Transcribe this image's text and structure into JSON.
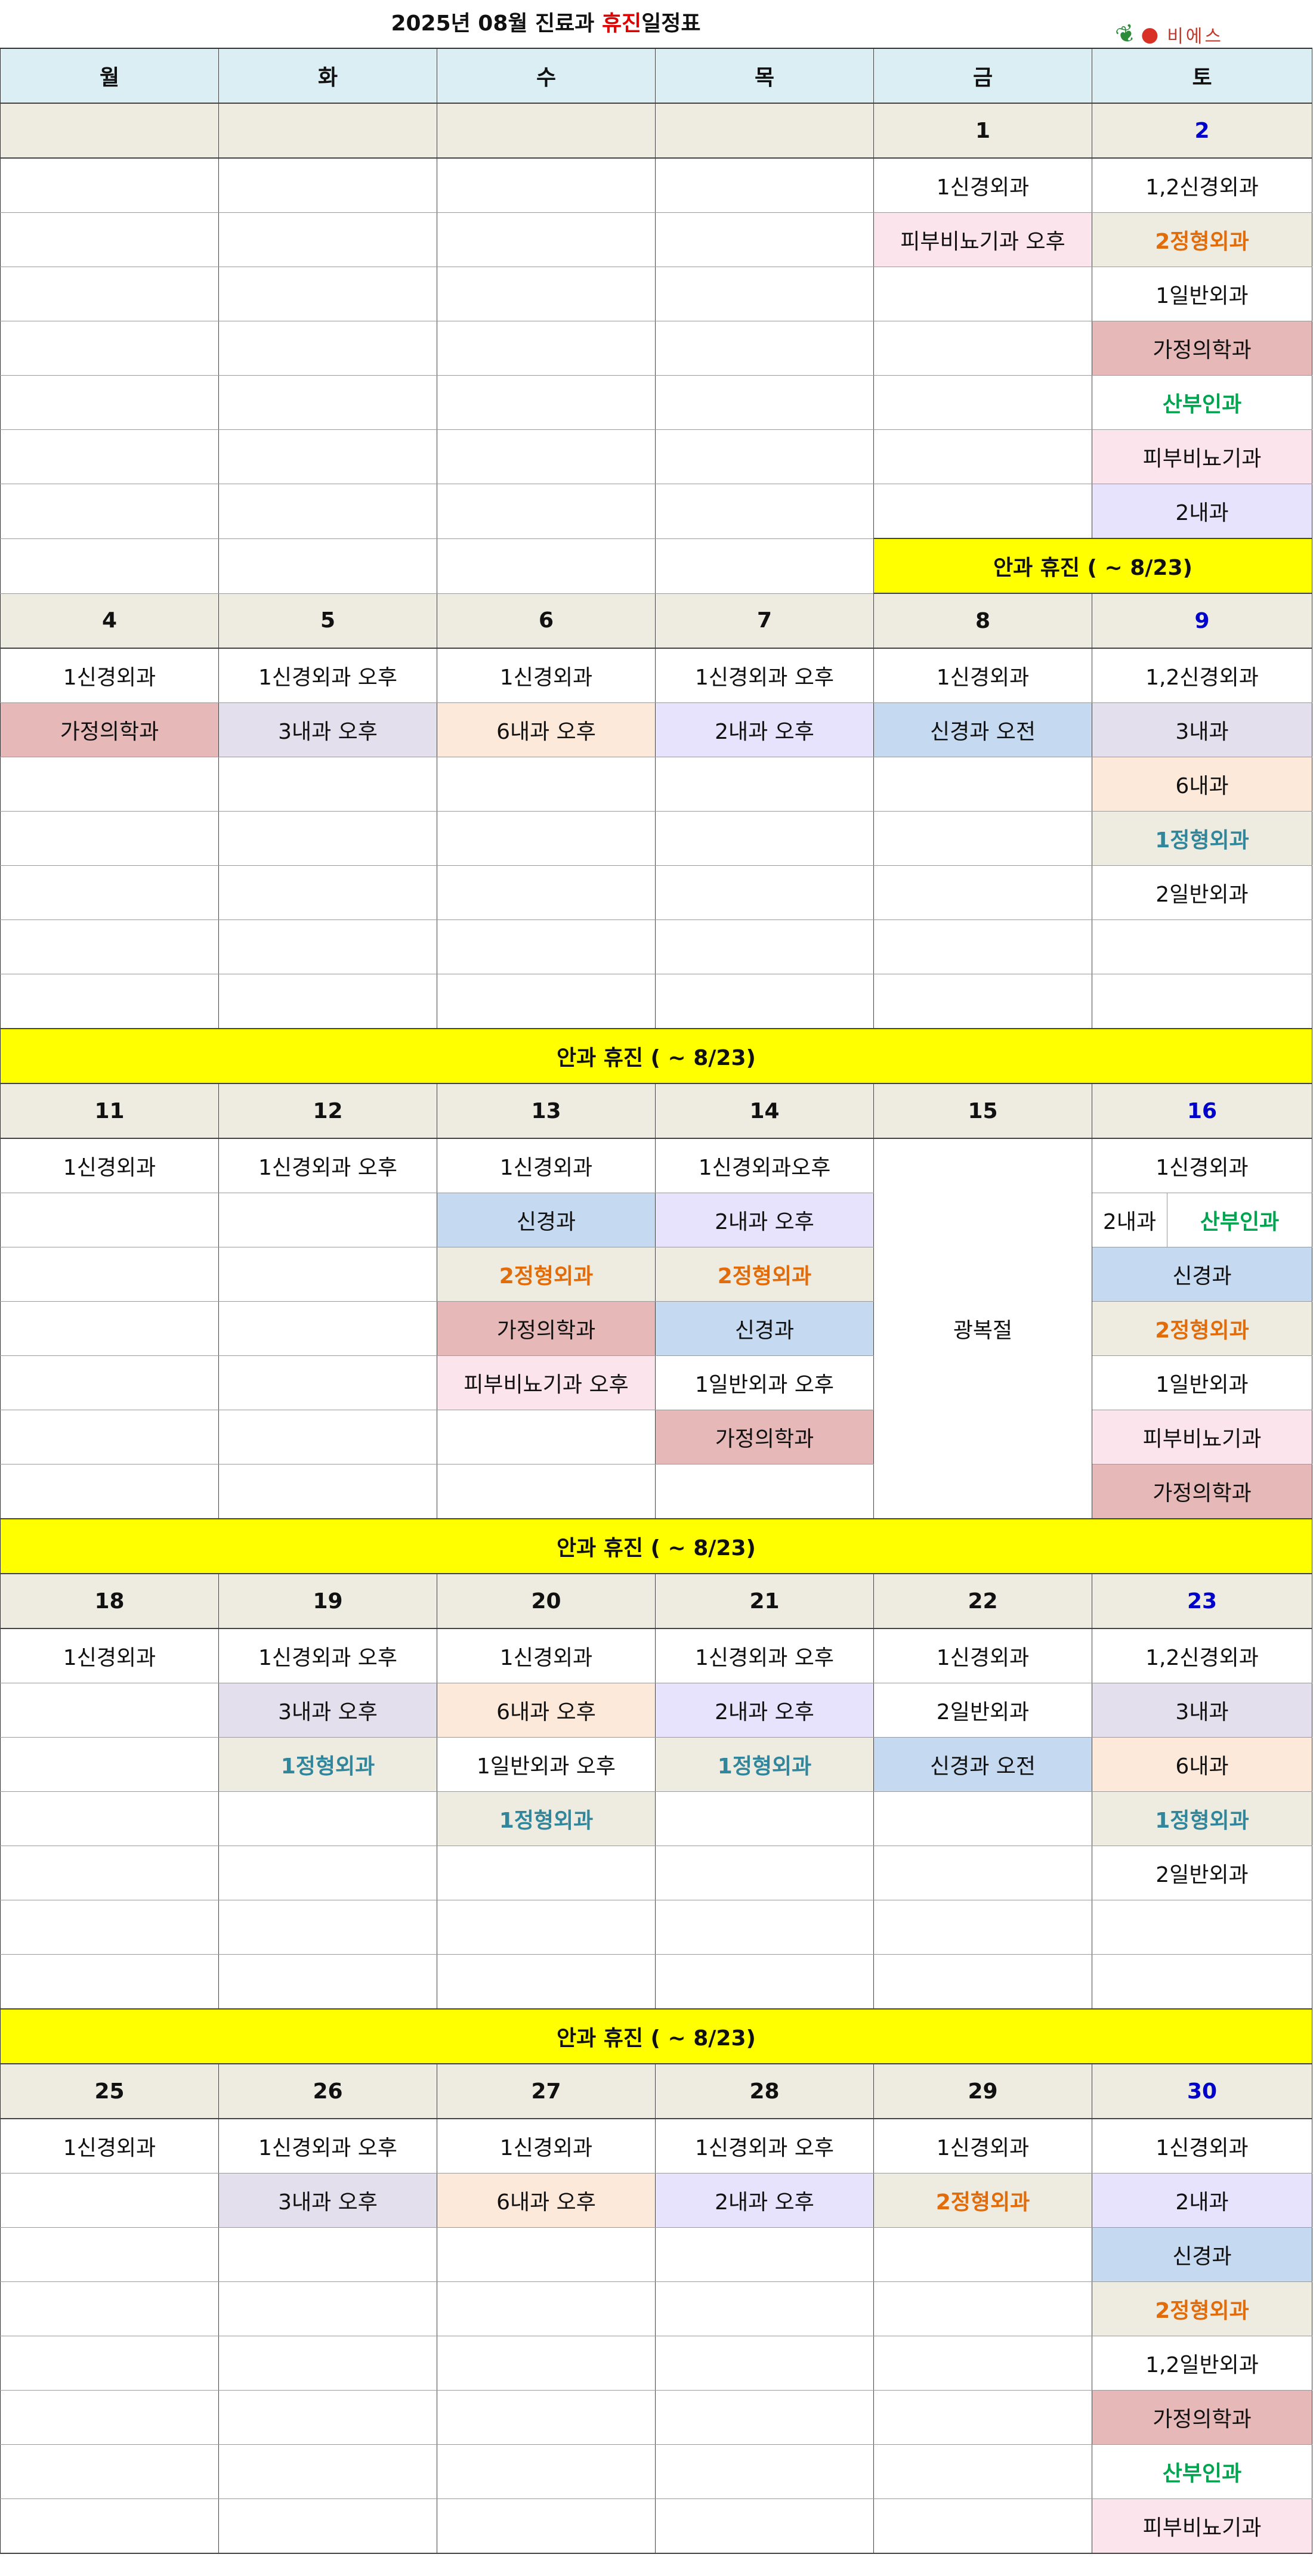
{
  "title": {
    "prefix": "2025년 08월 진료과 ",
    "highlight": "휴진",
    "suffix": "일정표"
  },
  "logo": {
    "name": "비에스"
  },
  "weekdays": [
    "월",
    "화",
    "수",
    "목",
    "금",
    "토"
  ],
  "notice": "안과 휴진 ( ~ 8/23)",
  "holiday": "광복절",
  "weeks": [
    {
      "dates": [
        "",
        "",
        "",
        "",
        "1",
        "2"
      ],
      "rows": [
        [
          "",
          "",
          "",
          "",
          "1신경외과",
          "1,2신경외과"
        ],
        [
          "",
          "",
          "",
          "",
          "피부비뇨기과 오후",
          "2정형외과"
        ],
        [
          "",
          "",
          "",
          "",
          "",
          "1일반외과"
        ],
        [
          "",
          "",
          "",
          "",
          "",
          "가정의학과"
        ],
        [
          "",
          "",
          "",
          "",
          "",
          "산부인과"
        ],
        [
          "",
          "",
          "",
          "",
          "",
          "피부비뇨기과"
        ],
        [
          "",
          "",
          "",
          "",
          "",
          "2내과"
        ]
      ],
      "notice_friday_saturday": "안과 휴진 ( ~ 8/23)"
    },
    {
      "dates": [
        "4",
        "5",
        "6",
        "7",
        "8",
        "9"
      ],
      "rows": [
        [
          "1신경외과",
          "1신경외과 오후",
          "1신경외과",
          "1신경외과 오후",
          "1신경외과",
          "1,2신경외과"
        ],
        [
          "가정의학과",
          "3내과 오후",
          "6내과 오후",
          "2내과 오후",
          "신경과 오전",
          "3내과"
        ],
        [
          "",
          "",
          "",
          "",
          "",
          "6내과"
        ],
        [
          "",
          "",
          "",
          "",
          "",
          "1정형외과"
        ],
        [
          "",
          "",
          "",
          "",
          "",
          "2일반외과"
        ],
        [
          "",
          "",
          "",
          "",
          "",
          ""
        ],
        [
          "",
          "",
          "",
          "",
          "",
          ""
        ]
      ]
    },
    {
      "dates": [
        "11",
        "12",
        "13",
        "14",
        "15",
        "16"
      ],
      "rows": [
        [
          "1신경외과",
          "1신경외과 오후",
          "1신경외과",
          "1신경외과오후",
          "",
          "1신경외과"
        ],
        [
          "",
          "",
          "신경과",
          "2내과 오후",
          "",
          ""
        ],
        [
          "",
          "",
          "2정형외과",
          "2정형외과",
          "",
          "신경과"
        ],
        [
          "",
          "",
          "가정의학과",
          "신경과",
          "",
          "2정형외과"
        ],
        [
          "",
          "",
          "피부비뇨기과 오후",
          "1일반외과 오후",
          "",
          "1일반외과"
        ],
        [
          "",
          "",
          "",
          "가정의학과",
          "",
          "피부비뇨기과"
        ],
        [
          "",
          "",
          "",
          "",
          "",
          "가정의학과"
        ]
      ],
      "split_cell": {
        "a": "2내과",
        "b": "산부인과"
      }
    },
    {
      "dates": [
        "18",
        "19",
        "20",
        "21",
        "22",
        "23"
      ],
      "rows": [
        [
          "1신경외과",
          "1신경외과 오후",
          "1신경외과",
          "1신경외과 오후",
          "1신경외과",
          "1,2신경외과"
        ],
        [
          "",
          "3내과 오후",
          "6내과 오후",
          "2내과 오후",
          "2일반외과",
          "3내과"
        ],
        [
          "",
          "1정형외과",
          "1일반외과 오후",
          "1정형외과",
          "신경과 오전",
          "6내과"
        ],
        [
          "",
          "",
          "1정형외과",
          "",
          "",
          "1정형외과"
        ],
        [
          "",
          "",
          "",
          "",
          "",
          "2일반외과"
        ],
        [
          "",
          "",
          "",
          "",
          "",
          ""
        ],
        [
          "",
          "",
          "",
          "",
          "",
          ""
        ]
      ]
    },
    {
      "dates": [
        "25",
        "26",
        "27",
        "28",
        "29",
        "30"
      ],
      "rows": [
        [
          "1신경외과",
          "1신경외과 오후",
          "1신경외과",
          "1신경외과 오후",
          "1신경외과",
          "1신경외과"
        ],
        [
          "",
          "3내과 오후",
          "6내과 오후",
          "2내과 오후",
          "2정형외과",
          "2내과"
        ],
        [
          "",
          "",
          "",
          "",
          "",
          "신경과"
        ],
        [
          "",
          "",
          "",
          "",
          "",
          "2정형외과"
        ],
        [
          "",
          "",
          "",
          "",
          "",
          "1,2일반외과"
        ],
        [
          "",
          "",
          "",
          "",
          "",
          "가정의학과"
        ],
        [
          "",
          "",
          "",
          "",
          "",
          "산부인과"
        ],
        [
          "",
          "",
          "",
          "",
          "",
          "피부비뇨기과"
        ]
      ]
    }
  ],
  "cell_styles": {
    "0-1-4": "bg-pink",
    "0-1-5": "bg-beige fc-orange",
    "0-3-5": "bg-rose",
    "0-4-5": "fc-green",
    "0-5-5": "bg-pink",
    "0-6-5": "bg-purple",
    "1-1-0": "bg-rose",
    "1-1-1": "bg-lav",
    "1-1-2": "bg-peach",
    "1-1-3": "bg-purple",
    "1-1-4": "bg-blue",
    "1-1-5": "bg-lav",
    "1-2-5": "bg-peach",
    "1-3-5": "bg-beige fc-teal",
    "2-1-2": "bg-blue",
    "2-1-3": "bg-purple",
    "2-2-2": "bg-beige fc-orange",
    "2-2-3": "bg-beige fc-orange",
    "2-2-5": "bg-blue",
    "2-3-2": "bg-rose",
    "2-3-3": "bg-blue",
    "2-3-5": "bg-beige fc-orange",
    "2-4-2": "bg-pink",
    "2-5-3": "bg-rose",
    "2-5-5": "bg-pink",
    "2-6-5": "bg-rose",
    "3-1-1": "bg-lav",
    "3-1-2": "bg-peach",
    "3-1-3": "bg-purple",
    "3-1-5": "bg-lav",
    "3-2-1": "bg-beige fc-teal",
    "3-2-3": "bg-beige fc-teal",
    "3-2-4": "bg-blue",
    "3-2-5": "bg-peach",
    "3-3-2": "bg-beige fc-teal",
    "3-3-5": "bg-beige fc-teal",
    "4-1-1": "bg-lav",
    "4-1-2": "bg-peach",
    "4-1-3": "bg-purple",
    "4-1-4": "bg-beige fc-orange",
    "4-1-5": "bg-purple",
    "4-2-5": "bg-blue",
    "4-3-5": "bg-beige fc-orange",
    "4-5-5": "bg-rose",
    "4-6-5": "fc-green",
    "4-7-5": "bg-pink"
  },
  "split_style": {
    "b": "fc-green"
  }
}
